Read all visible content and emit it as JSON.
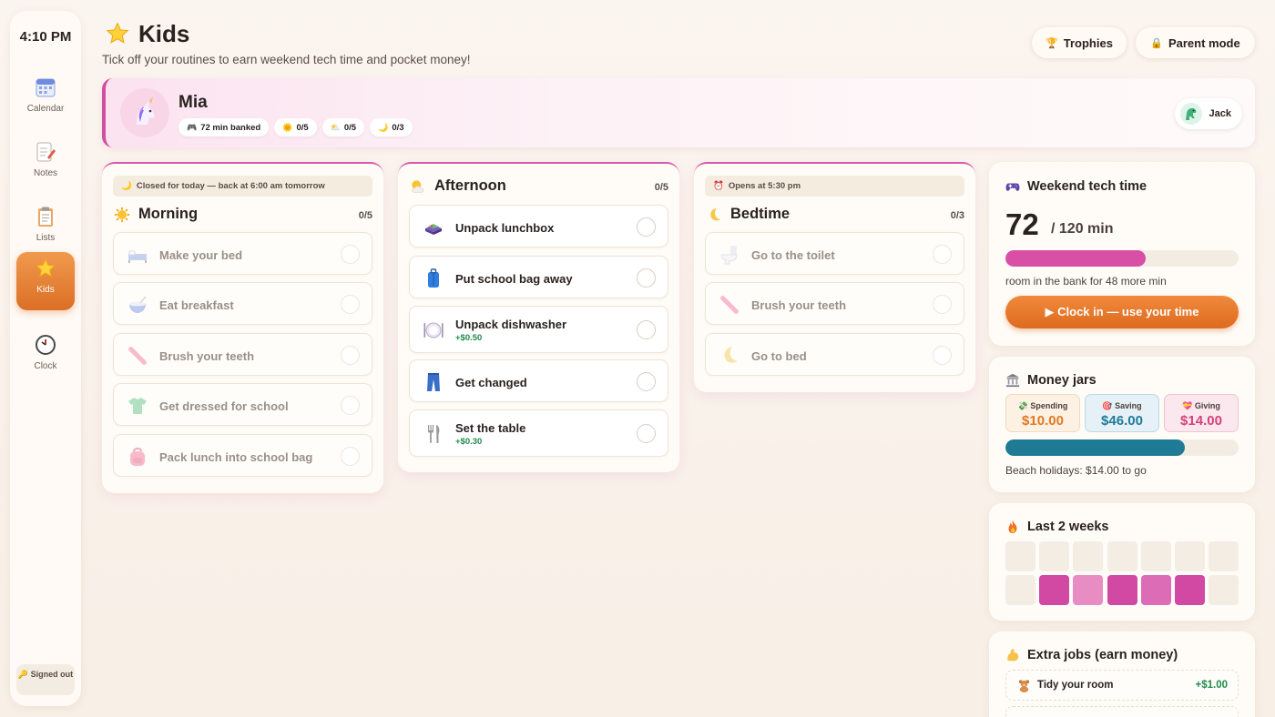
{
  "sidebar": {
    "time": "4:10 PM",
    "items": [
      {
        "label": "Calendar",
        "icon": "calendar-icon"
      },
      {
        "label": "Notes",
        "icon": "notes-icon"
      },
      {
        "label": "Lists",
        "icon": "clipboard-icon"
      },
      {
        "label": "Kids",
        "icon": "star-icon",
        "active": true
      },
      {
        "label": "Clock",
        "icon": "clock-icon"
      }
    ],
    "signed_out_emoji": "🔑",
    "signed_out_label": "Signed out"
  },
  "header": {
    "title": "Kids",
    "subtitle": "Tick off your routines to earn weekend tech time and pocket money!",
    "trophies_emoji": "🏆",
    "trophies_label": "Trophies",
    "parent_emoji": "🔒",
    "parent_label": "Parent mode"
  },
  "profile": {
    "name": "Mia",
    "avatar_icon": "unicorn-icon",
    "chips": [
      {
        "emoji": "🎮",
        "label": "72 min banked"
      },
      {
        "emoji": "🌞",
        "label": "0/5"
      },
      {
        "emoji": "⛅",
        "label": "0/5"
      },
      {
        "emoji": "🌙",
        "label": "0/3"
      }
    ],
    "other_kid": {
      "name": "Jack",
      "avatar_icon": "dinosaur-icon"
    }
  },
  "routines": {
    "morning": {
      "banner_emoji": "🌙",
      "banner": "Closed for today — back at 6:00 am tomorrow",
      "title": "Morning",
      "count": "0/5",
      "tasks": [
        {
          "label": "Make your bed",
          "icon": "bed-icon"
        },
        {
          "label": "Eat breakfast",
          "icon": "bowl-icon"
        },
        {
          "label": "Brush your teeth",
          "icon": "toothbrush-icon"
        },
        {
          "label": "Get dressed for school",
          "icon": "shirt-icon"
        },
        {
          "label": "Pack lunch into school bag",
          "icon": "backpack-icon"
        }
      ]
    },
    "afternoon": {
      "title": "Afternoon",
      "count": "0/5",
      "tasks": [
        {
          "label": "Unpack lunchbox",
          "icon": "lunchbox-icon",
          "reward": ""
        },
        {
          "label": "Put school bag away",
          "icon": "suitcase-icon",
          "reward": ""
        },
        {
          "label": "Unpack dishwasher",
          "icon": "plate-icon",
          "reward": "+$0.50"
        },
        {
          "label": "Get changed",
          "icon": "jeans-icon",
          "reward": ""
        },
        {
          "label": "Set the table",
          "icon": "cutlery-icon",
          "reward": "+$0.30"
        }
      ]
    },
    "bedtime": {
      "banner_emoji": "⏰",
      "banner": "Opens at 5:30 pm",
      "title": "Bedtime",
      "count": "0/3",
      "tasks": [
        {
          "label": "Go to the toilet",
          "icon": "toilet-icon"
        },
        {
          "label": "Brush your teeth",
          "icon": "toothbrush-icon"
        },
        {
          "label": "Go to bed",
          "icon": "moon-icon"
        }
      ]
    }
  },
  "tech_time": {
    "title": "Weekend tech time",
    "minutes": "72",
    "of_label": "/ 120 min",
    "progress": 0.6,
    "note": "room in the bank for 48 more min",
    "button_label": "▶ Clock in — use your time",
    "colors": {
      "fill": "#d84fa6",
      "track": "#f3ece2"
    }
  },
  "money_jars": {
    "title": "Money jars",
    "jars": [
      {
        "emoji": "💸",
        "label": "Spending",
        "amount": "$10.00",
        "color": "#e07a22",
        "bg": "#fdf1e4",
        "border": "#f2d9bd"
      },
      {
        "emoji": "🎯",
        "label": "Saving",
        "amount": "$46.00",
        "color": "#1f7a96",
        "bg": "#e6f1f7",
        "border": "#bcd8e6"
      },
      {
        "emoji": "💝",
        "label": "Giving",
        "amount": "$14.00",
        "color": "#d4427a",
        "bg": "#fbe7ee",
        "border": "#f0c3d2"
      }
    ],
    "goal_progress": 0.77,
    "goal_color": "#1f7a96",
    "note": "Beach holidays: $14.00 to go"
  },
  "streak": {
    "title": "Last 2 weeks",
    "levels": [
      0,
      0,
      0,
      0,
      0,
      0,
      0,
      0,
      3,
      1,
      3,
      2,
      3,
      0
    ],
    "colors": [
      "#f3ede4",
      "#e88cc4",
      "#dd6cb6",
      "#d149a3"
    ]
  },
  "extra_jobs": {
    "title": "Extra jobs (earn money)",
    "jobs": [
      {
        "label": "Tidy your room",
        "icon": "teddy-icon",
        "reward": "+$1.00"
      }
    ]
  }
}
